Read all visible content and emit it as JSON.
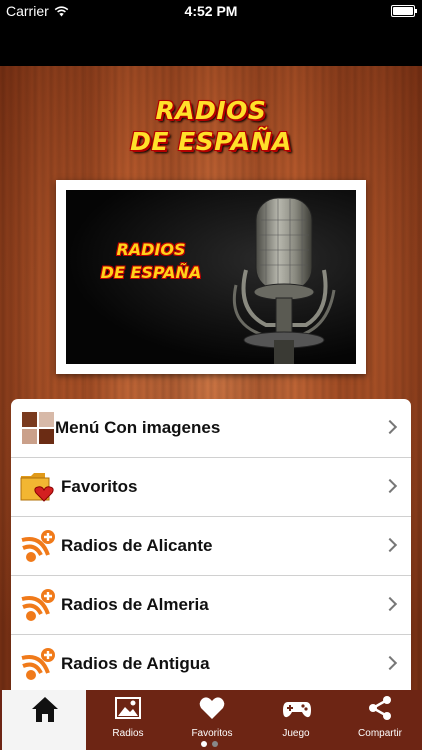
{
  "status_bar": {
    "carrier": "Carrier",
    "time": "4:52 PM"
  },
  "app_title": {
    "line1": "RADIOS",
    "line2": "DE ESPAÑA"
  },
  "banner": {
    "line1": "RADIOS",
    "line2": "DE ESPAÑA"
  },
  "menu": {
    "items": [
      {
        "label": "Menú Con imagenes",
        "icon": "grid-icon"
      },
      {
        "label": "Favoritos",
        "icon": "folder-heart-icon"
      },
      {
        "label": "Radios de Alicante",
        "icon": "radio-add-icon"
      },
      {
        "label": "Radios de Almeria",
        "icon": "radio-add-icon"
      },
      {
        "label": "Radios de Antigua",
        "icon": "radio-add-icon"
      }
    ]
  },
  "tabs": [
    {
      "label": "",
      "icon": "home-icon",
      "active": true
    },
    {
      "label": "Radios",
      "icon": "image-icon"
    },
    {
      "label": "Favoritos",
      "icon": "heart-icon"
    },
    {
      "label": "Juego",
      "icon": "gamepad-icon"
    },
    {
      "label": "Compartir",
      "icon": "share-icon"
    }
  ],
  "colors": {
    "tabbar": "#6d2514",
    "logo_yellow": "#ffe02a",
    "logo_red": "#b20000"
  }
}
